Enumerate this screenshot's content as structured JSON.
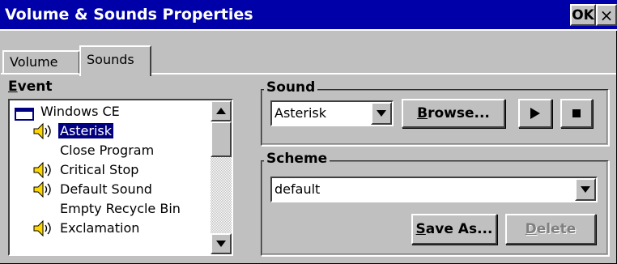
{
  "window": {
    "title": "Volume & Sounds Properties",
    "ok_label": "OK",
    "close_label": "×"
  },
  "tabs": [
    {
      "label": "Volume",
      "active": false
    },
    {
      "label": "Sounds",
      "active": true
    }
  ],
  "event": {
    "label_mnemonic": "E",
    "label_rest": "vent",
    "items": [
      {
        "label": "Windows CE",
        "icon": "folder-icon",
        "selected": false
      },
      {
        "label": "Asterisk",
        "icon": "speaker-icon",
        "selected": true
      },
      {
        "label": "Close Program",
        "icon": "none",
        "selected": false
      },
      {
        "label": "Critical Stop",
        "icon": "speaker-icon",
        "selected": false
      },
      {
        "label": "Default Sound",
        "icon": "speaker-icon",
        "selected": false
      },
      {
        "label": "Empty Recycle Bin",
        "icon": "none",
        "selected": false
      },
      {
        "label": "Exclamation",
        "icon": "speaker-icon",
        "selected": false
      }
    ]
  },
  "sound": {
    "group_label": "Sound",
    "selected_value": "Asterisk",
    "browse_mnemonic": "B",
    "browse_rest": "rowse...",
    "play_icon": "play-icon",
    "stop_icon": "stop-icon"
  },
  "scheme": {
    "group_label": "Scheme",
    "selected_value": "default",
    "save_as_mnemonic": "S",
    "save_as_rest": "ave As...",
    "delete_mnemonic": "D",
    "delete_rest": "elete"
  },
  "colors": {
    "titlebar": "#0000a8",
    "face": "#c0c0c0",
    "selection": "#000080"
  }
}
